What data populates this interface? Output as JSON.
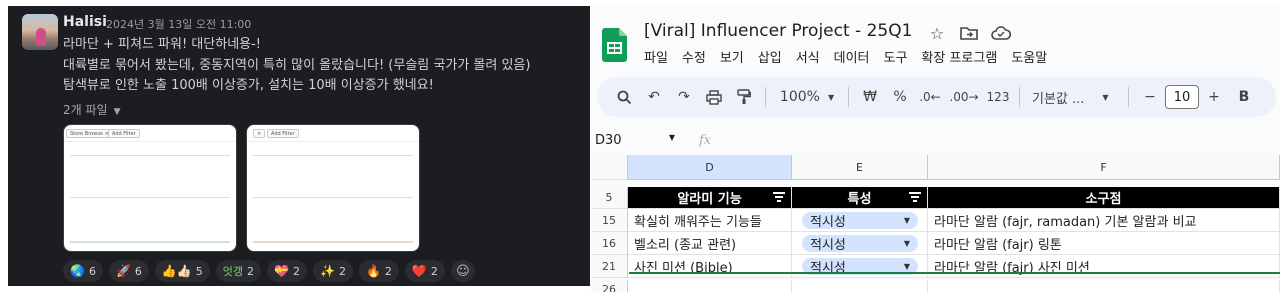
{
  "slack": {
    "author": "Halisi",
    "timestamp": "2024년 3월 13일 오전 11:00",
    "lines": [
      "라마단 + 피쳐드 파워! 대단하네용-!",
      "대륙별로 묶어서 봤는데, 중동지역이 특히 많이 올랐습니다! (무슬림 국가가 몰려 있음)",
      "탐색뷰로 인한 노출 100배 이상증가, 설치는 10배 이상증가 했네요!"
    ],
    "files_label": "2개 파일",
    "thumb1_chips": [
      "Store Browse  ×",
      "Add Filter"
    ],
    "thumb2_chips": [
      "×",
      "Add Filter"
    ],
    "reactions": [
      {
        "emoji": "🌏",
        "count": "6",
        "icon": "earth-emoji-icon"
      },
      {
        "emoji": "🚀",
        "count": "6",
        "icon": "rocket-emoji-icon"
      },
      {
        "emoji": "👍👍🏻",
        "count": "5",
        "icon": "thumbs-up-emoji-icon"
      },
      {
        "emoji": "엇갱",
        "count": "2",
        "icon": "custom-text-emoji-icon"
      },
      {
        "emoji": "💝",
        "count": "2",
        "icon": "heart-gift-emoji-icon"
      },
      {
        "emoji": "✨",
        "count": "2",
        "icon": "sparkles-emoji-icon"
      },
      {
        "emoji": "🔥",
        "count": "2",
        "icon": "fire-emoji-icon"
      },
      {
        "emoji": "❤️",
        "count": "2",
        "icon": "red-heart-emoji-icon"
      }
    ]
  },
  "sheets": {
    "title": "[Viral] Influencer Project - 25Q1",
    "menu": [
      "파일",
      "수정",
      "보기",
      "삽입",
      "서식",
      "데이터",
      "도구",
      "확장 프로그램",
      "도움말"
    ],
    "toolbar": {
      "zoom": "100%",
      "currency": "₩",
      "percent": "%",
      "dec_decrease": ".0←",
      "dec_increase": ".00→",
      "number_format": "123",
      "font": "기본값 ...",
      "font_size": "10"
    },
    "name_box": "D30",
    "fx": "fx",
    "columns": [
      "D",
      "E",
      "F"
    ],
    "header_row": {
      "num": "5",
      "d": "알라미 기능",
      "e": "특성",
      "f": "소구점"
    },
    "rows": [
      {
        "num": "15",
        "d": "확실히 깨워주는 기능들",
        "e": "적시성",
        "f": "라마단 알람 (fajr, ramadan) 기본 알람과 비교"
      },
      {
        "num": "16",
        "d": "벨소리 (종교 관련)",
        "e": "적시성",
        "f": "라마단 알람 (fajr) 링톤"
      },
      {
        "num": "21",
        "d": "사진 미션 (Bible)",
        "e": "적시성",
        "f": "라마단 알람 (fajr) 사진 미션"
      }
    ],
    "next_row_num": "26",
    "colors": {
      "accent": "#188038",
      "chip": "#d3e3fd",
      "toolbar_bg": "#edf2fa"
    }
  }
}
